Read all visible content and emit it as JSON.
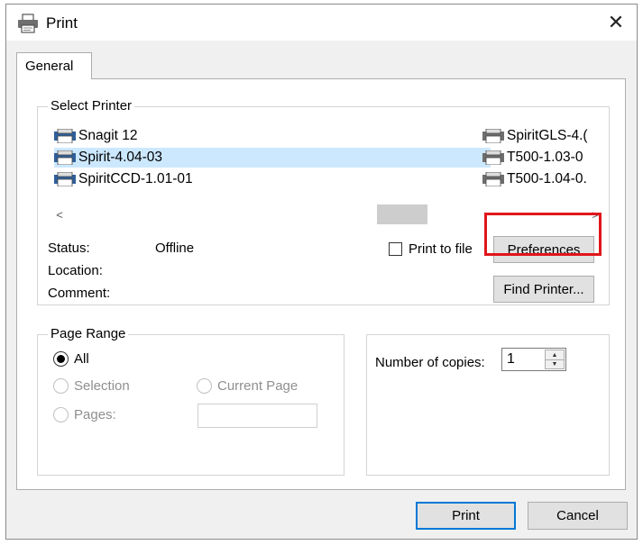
{
  "window": {
    "title": "Print",
    "close_glyph": "✕"
  },
  "tabs": [
    {
      "label": "General"
    }
  ],
  "select_printer": {
    "legend": "Select Printer",
    "printers_left": [
      "Snagit 12",
      "Spirit-4.04-03",
      "SpiritCCD-1.01-01"
    ],
    "printers_right": [
      "SpiritGLS-4.(",
      "T500-1.03-0",
      "T500-1.04-0."
    ],
    "selected": "Spirit-4.04-03",
    "scroll_left_glyph": "<",
    "scroll_right_glyph": ">",
    "status_label": "Status:",
    "status_value": "Offline",
    "location_label": "Location:",
    "comment_label": "Comment:",
    "print_to_file_label": "Print to file",
    "print_to_file_checked": false,
    "preferences_button": "Preferences",
    "find_printer_button": "Find Printer..."
  },
  "page_range": {
    "legend": "Page Range",
    "all_label": "All",
    "selection_label": "Selection",
    "current_page_label": "Current Page",
    "pages_label": "Pages:",
    "pages_value": "",
    "selected": "All"
  },
  "copies": {
    "label": "Number of copies:",
    "value": "1"
  },
  "footer": {
    "print_button": "Print",
    "cancel_button": "Cancel"
  },
  "colors": {
    "selection_bg": "#cce8ff",
    "highlight_box": "#e0161b",
    "default_button_border": "#0078d7"
  },
  "icons": {
    "title": "printer-icon",
    "printer_item": "printer-icon",
    "close": "close-icon"
  }
}
